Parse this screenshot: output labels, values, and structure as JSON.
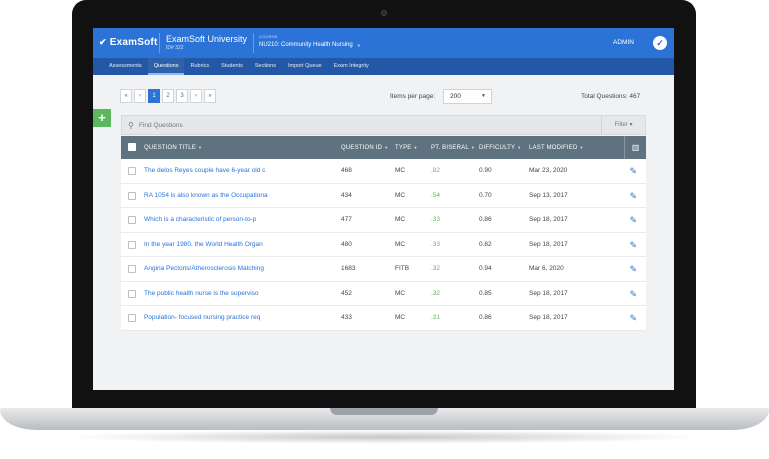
{
  "header": {
    "logo": "ExamSoft",
    "university_name": "ExamSoft University",
    "university_id": "ID# 322",
    "course_label": "COURSE",
    "course_value": "NU210: Community Health Nursing",
    "user_label": "ADMIN"
  },
  "nav": {
    "items": [
      {
        "label": "Assessments"
      },
      {
        "label": "Questions"
      },
      {
        "label": "Rubrics"
      },
      {
        "label": "Students"
      },
      {
        "label": "Sections"
      },
      {
        "label": "Import Queue"
      },
      {
        "label": "Exam Integrity"
      }
    ],
    "active": "Questions"
  },
  "pagination": {
    "first": "«",
    "prev": "‹",
    "pages": [
      "1",
      "2",
      "3"
    ],
    "current_page": "1",
    "next": "›",
    "last": "»"
  },
  "items_per_page": {
    "label": "Items per page:",
    "value": "200"
  },
  "total_questions": "Total Questions: 467",
  "search": {
    "placeholder": "Find Questions",
    "filter_label": "Filter ▾"
  },
  "table": {
    "columns": {
      "title": "QUESTION TITLE",
      "qid": "QUESTION ID",
      "type": "TYPE",
      "pb": "PT. BISERAL",
      "diff": "DIFFICULTY",
      "mod": "LAST MODIFIED"
    },
    "rows": [
      {
        "title": "The delos Reyes couple have 6-year old c",
        "qid": "468",
        "type": "MC",
        "pb": ".82",
        "diff": "0.90",
        "mod": "Mar 23, 2020"
      },
      {
        "title": "RA 1054 is also known as the Occupationa",
        "qid": "434",
        "type": "MC",
        "pb": ".54",
        "diff": "0.70",
        "mod": "Sep 13, 2017"
      },
      {
        "title": "Which is a characteristic of person-to-p",
        "qid": "477",
        "type": "MC",
        "pb": ".33",
        "diff": "0.86",
        "mod": "Sep 18, 2017"
      },
      {
        "title": "In the year 1980, the World Health Organ",
        "qid": "480",
        "type": "MC",
        "pb": ".33",
        "diff": "0.82",
        "mod": "Sep 18, 2017"
      },
      {
        "title": "Angina Pectoris/Atherosclerosis Matching",
        "qid": "1683",
        "type": "FITB",
        "pb": ".32",
        "diff": "0.94",
        "mod": "Mar 6, 2020"
      },
      {
        "title": "The public health nurse is the superviso",
        "qid": "452",
        "type": "MC",
        "pb": ".32",
        "diff": "0.85",
        "mod": "Sep 18, 2017"
      },
      {
        "title": "Population- focused nursing practice req",
        "qid": "433",
        "type": "MC",
        "pb": ".31",
        "diff": "0.86",
        "mod": "Sep 18, 2017"
      }
    ]
  },
  "colors": {
    "brand_blue": "#2b73d6",
    "nav_blue": "#2358a6",
    "header_gray": "#5e7280",
    "positive_green": "#5cb85c"
  },
  "icons": [
    "check-circle-icon",
    "plus-icon",
    "search-icon",
    "columns-icon",
    "edit-pencil-icon",
    "sort-caret-icon"
  ]
}
